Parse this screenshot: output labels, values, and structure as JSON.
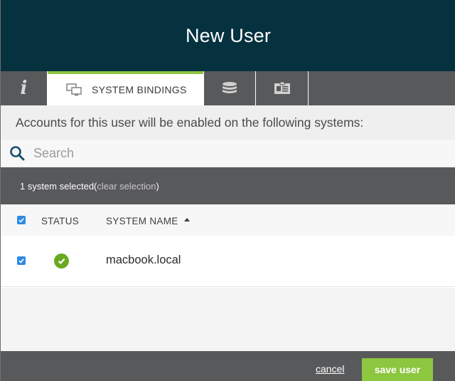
{
  "header": {
    "title": "New User"
  },
  "tabs": {
    "info_glyph": "i",
    "active_label": "SYSTEM BINDINGS",
    "icons": [
      "info-icon",
      "systems-icon",
      "database-icon",
      "directory-icon"
    ]
  },
  "notice": {
    "text": "Accounts for this user will be enabled on the following systems:"
  },
  "search": {
    "placeholder": "Search",
    "value": ""
  },
  "selection": {
    "count_text": "1 system selected",
    "open_paren": " (",
    "clear_label": "clear selection",
    "close_paren": ")"
  },
  "table": {
    "columns": {
      "status": "STATUS",
      "name": "SYSTEM NAME"
    },
    "rows": [
      {
        "checked": true,
        "status": "ok",
        "name": "macbook.local"
      }
    ]
  },
  "footer": {
    "cancel_label": "cancel",
    "save_label": "save user"
  },
  "colors": {
    "header_bg": "#06323f",
    "accent_green": "#8dc63f",
    "bar_gray": "#58595b",
    "checkbox_blue": "#2f8ae2",
    "status_green": "#6aa920"
  }
}
